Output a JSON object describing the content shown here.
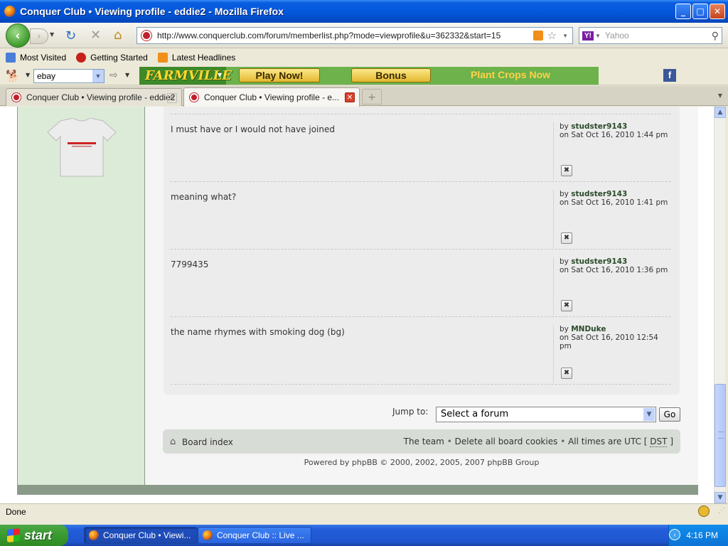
{
  "window": {
    "title": "Conquer Club • Viewing profile - eddie2 - Mozilla Firefox"
  },
  "navbar": {
    "url": "http://www.conquerclub.com/forum/memberlist.php?mode=viewprofile&u=362332&start=15",
    "search_placeholder": "Yahoo",
    "search_engine_icon": "Y!"
  },
  "bookmarks": [
    {
      "label": "Most Visited"
    },
    {
      "label": "Getting Started"
    },
    {
      "label": "Latest Headlines"
    }
  ],
  "toolbar2": {
    "search_value": "ebay",
    "farmville_logo": "FARMVILLE",
    "play_now": "Play Now!",
    "bonus": "Bonus",
    "plant_crops": "Plant Crops Now",
    "facebook": "f"
  },
  "tabs": [
    {
      "label": "Conquer Club • Viewing profile - eddie2",
      "active": false
    },
    {
      "label": "Conquer Club • Viewing profile - e...",
      "active": true
    }
  ],
  "posts": [
    {
      "text": "I must have or I would not have joined",
      "by": "by",
      "author": "studster9143",
      "date": "on Sat Oct 16, 2010 1:44 pm"
    },
    {
      "text": "meaning what?",
      "by": "by",
      "author": "studster9143",
      "date": "on Sat Oct 16, 2010 1:41 pm"
    },
    {
      "text": "7799435",
      "by": "by",
      "author": "studster9143",
      "date": "on Sat Oct 16, 2010 1:36 pm"
    },
    {
      "text": "the name rhymes with smoking dog (bg)",
      "by": "by",
      "author": "MNDuke",
      "date": "on Sat Oct 16, 2010 12:54 pm"
    }
  ],
  "jump": {
    "label": "Jump to:",
    "selected": "Select a forum",
    "go": "Go"
  },
  "footer": {
    "board_index": "Board index",
    "team": "The team",
    "delete_cookies": "Delete all board cookies",
    "times": "All times are UTC [",
    "dst": "DST",
    "times_end": "]",
    "powered_by": "Powered by phpBB © 2000, 2002, 2005, 2007 phpBB Group"
  },
  "status": {
    "text": "Done"
  },
  "taskbar": {
    "start": "start",
    "tasks": [
      {
        "label": "Conquer Club • Viewi..."
      },
      {
        "label": "Conquer Club :: Live ..."
      }
    ],
    "clock": "4:16 PM"
  }
}
